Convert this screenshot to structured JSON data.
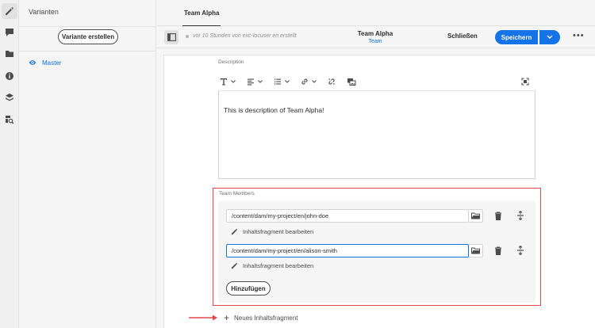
{
  "rail": {
    "icons": [
      "edit-icon",
      "comment-icon",
      "folder-icon",
      "info-icon",
      "layers-icon",
      "search-references-icon"
    ]
  },
  "variants": {
    "title": "Varianten",
    "create_label": "Variante erstellen",
    "items": [
      {
        "label": "Master",
        "selected": true
      }
    ]
  },
  "tabs": [
    {
      "label": "Team Alpha",
      "active": true
    }
  ],
  "header": {
    "meta": "vor 10 Stunden von exc-locuser en erstellt",
    "title": "Team Alpha",
    "model": "Team",
    "close_label": "Schließen",
    "save_label": "Speichern",
    "more_label": "•••"
  },
  "editor": {
    "description": {
      "label": "Description",
      "text": "This is description of Team Alpha!"
    },
    "team_members": {
      "label": "Team Members",
      "items": [
        {
          "path": "/content/dam/my-project/en/john-doe",
          "edit_label": "Inhaltsfragment bearbeiten",
          "focused": false
        },
        {
          "path": "/content/dam/my-project/en/alison-smith",
          "edit_label": "Inhaltsfragment bearbeiten",
          "focused": true
        }
      ],
      "add_label": "Hinzufügen"
    },
    "new_fragment_label": "Neues Inhaltsfragment"
  },
  "colors": {
    "accent": "#1473e6",
    "highlight": "#e34850"
  }
}
